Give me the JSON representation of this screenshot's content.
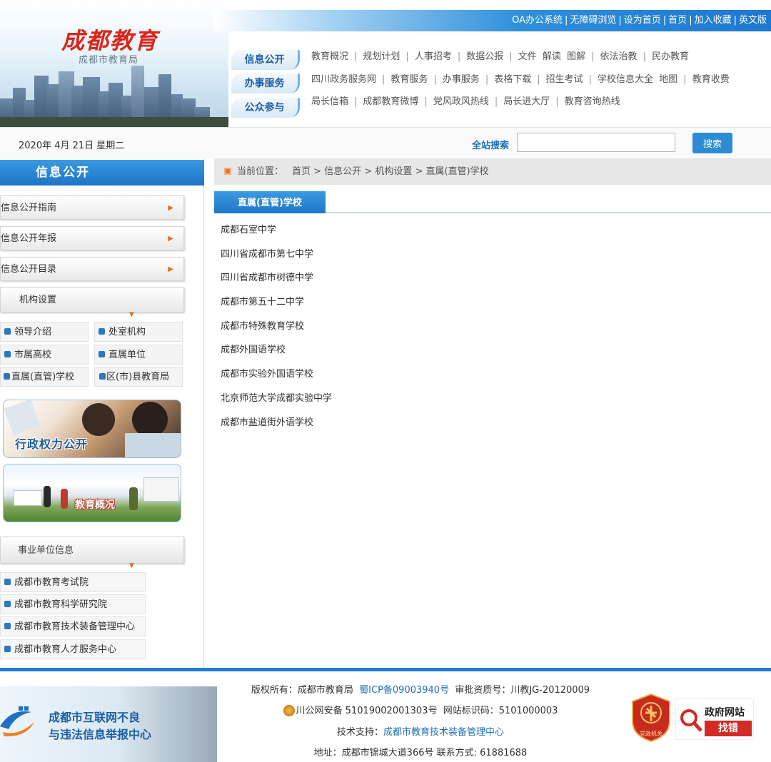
{
  "header": {
    "logo_main": "成都教育",
    "logo_sub": "成都市教育局",
    "top_links": [
      "OA办公系统",
      "无障碍浏览",
      "设为首页",
      "首页",
      "加入收藏",
      "英文版"
    ],
    "categories": [
      {
        "label": "信息公开",
        "items": [
          "教育概况",
          "规划计划",
          "人事招考",
          "数据公报",
          "文件  解读  图解",
          "依法治教",
          "民办教育"
        ]
      },
      {
        "label": "办事服务",
        "items": [
          "四川政务服务网",
          "教育服务",
          "办事服务",
          "表格下载",
          "招生考试",
          "学校信息大全  地图",
          "教育收费"
        ]
      },
      {
        "label": "公众参与",
        "items": [
          "局长信箱",
          "成都教育微博",
          "党风政风热线",
          "局长进大厅",
          "教育咨询热线"
        ]
      }
    ]
  },
  "search_bar": {
    "date": "2020年 4月 21日 星期二",
    "label": "全站搜索",
    "input_value": "",
    "button": "搜索"
  },
  "sidebar": {
    "title": "信息公开",
    "nav": [
      "信息公开指南",
      "信息公开年报",
      "信息公开目录"
    ],
    "org_head": "机构设置",
    "org_items": [
      "领导介绍",
      "处室机构",
      "市属高校",
      "直属单位",
      "直属(直管)学校",
      "区(市)县教育局"
    ],
    "banner_power": "行政权力公开",
    "banner_overview": "教育概况",
    "unit_head": "事业单位信息",
    "units": [
      "成都市教育考试院",
      "成都市教育科学研究院",
      "成都市教育技术装备管理中心",
      "成都市教育人才服务中心"
    ]
  },
  "main": {
    "breadcrumb_label": "当前位置：",
    "breadcrumb_path": "首页 > 信息公开 > 机构设置 > 直属(直管)学校",
    "tab": "直属(直管)学校",
    "schools": [
      "成都石室中学",
      "四川省成都市第七中学",
      "四川省成都市树德中学",
      "成都市第五十二中学",
      "成都市特殊教育学校",
      "成都外国语学校",
      "成都市实验外国语学校",
      "北京师范大学成都实验中学",
      "成都市盐道街外语学校"
    ]
  },
  "footer": {
    "report_line1": "成都市互联网不良",
    "report_line2": "与违法信息举报中心",
    "copyright_prefix": "版权所有：成都市教育局",
    "icp": "蜀ICP备09003940号",
    "approval": "审批资质号：川教JG-20120009",
    "police": "川公网安备 51019002001303号",
    "site_id": "网站标识码：5101000003",
    "tech_prefix": "技术支持：",
    "tech_link": "成都市教育技术装备管理中心",
    "address": "地址：成都市锦城大道366号  联系方式: 61881688",
    "party_badge": "党政机关",
    "gov_badge_l1": "政府网站",
    "gov_badge_l2": "找错"
  },
  "colors": {
    "brand_blue": "#1f7ccf",
    "logo_red": "#d9261c",
    "accent_orange": "#e0731e"
  }
}
